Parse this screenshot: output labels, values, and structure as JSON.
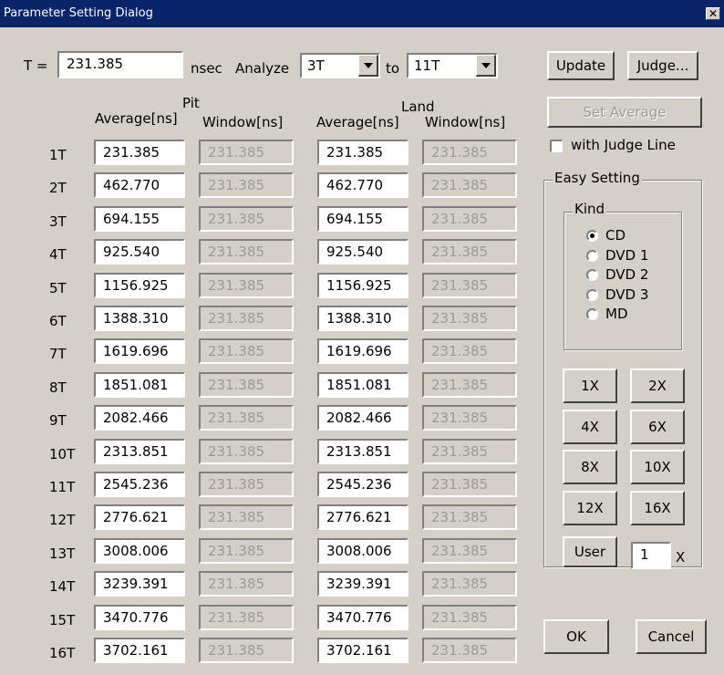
{
  "window": {
    "title": "Parameter Setting Dialog",
    "close_glyph": "✕"
  },
  "t_row": {
    "t_label": "T =",
    "t_value": "231.385",
    "unit": "nsec",
    "analyze_label": "Analyze",
    "from": "3T",
    "to_label": "to",
    "to": "11T"
  },
  "headers": {
    "pit": "Pit",
    "land": "Land",
    "average": "Average[ns]",
    "window": "Window[ns]"
  },
  "rows": [
    {
      "label": "1T",
      "pit_avg": "231.385",
      "pit_win": "231.385",
      "land_avg": "231.385",
      "land_win": "231.385"
    },
    {
      "label": "2T",
      "pit_avg": "462.770",
      "pit_win": "231.385",
      "land_avg": "462.770",
      "land_win": "231.385"
    },
    {
      "label": "3T",
      "pit_avg": "694.155",
      "pit_win": "231.385",
      "land_avg": "694.155",
      "land_win": "231.385"
    },
    {
      "label": "4T",
      "pit_avg": "925.540",
      "pit_win": "231.385",
      "land_avg": "925.540",
      "land_win": "231.385"
    },
    {
      "label": "5T",
      "pit_avg": "1156.925",
      "pit_win": "231.385",
      "land_avg": "1156.925",
      "land_win": "231.385"
    },
    {
      "label": "6T",
      "pit_avg": "1388.310",
      "pit_win": "231.385",
      "land_avg": "1388.310",
      "land_win": "231.385"
    },
    {
      "label": "7T",
      "pit_avg": "1619.696",
      "pit_win": "231.385",
      "land_avg": "1619.696",
      "land_win": "231.385"
    },
    {
      "label": "8T",
      "pit_avg": "1851.081",
      "pit_win": "231.385",
      "land_avg": "1851.081",
      "land_win": "231.385"
    },
    {
      "label": "9T",
      "pit_avg": "2082.466",
      "pit_win": "231.385",
      "land_avg": "2082.466",
      "land_win": "231.385"
    },
    {
      "label": "10T",
      "pit_avg": "2313.851",
      "pit_win": "231.385",
      "land_avg": "2313.851",
      "land_win": "231.385"
    },
    {
      "label": "11T",
      "pit_avg": "2545.236",
      "pit_win": "231.385",
      "land_avg": "2545.236",
      "land_win": "231.385"
    },
    {
      "label": "12T",
      "pit_avg": "2776.621",
      "pit_win": "231.385",
      "land_avg": "2776.621",
      "land_win": "231.385"
    },
    {
      "label": "13T",
      "pit_avg": "3008.006",
      "pit_win": "231.385",
      "land_avg": "3008.006",
      "land_win": "231.385"
    },
    {
      "label": "14T",
      "pit_avg": "3239.391",
      "pit_win": "231.385",
      "land_avg": "3239.391",
      "land_win": "231.385"
    },
    {
      "label": "15T",
      "pit_avg": "3470.776",
      "pit_win": "231.385",
      "land_avg": "3470.776",
      "land_win": "231.385"
    },
    {
      "label": "16T",
      "pit_avg": "3702.161",
      "pit_win": "231.385",
      "land_avg": "3702.161",
      "land_win": "231.385"
    }
  ],
  "buttons": {
    "update": "Update",
    "judge": "Judge...",
    "set_average": "Set Average",
    "ok": "OK",
    "cancel": "Cancel",
    "user": "User"
  },
  "judge_line": {
    "label": "with Judge Line",
    "checked": false
  },
  "easy_setting": {
    "title": "Easy Setting",
    "kind_title": "Kind",
    "kinds": [
      {
        "label": "CD",
        "selected": true
      },
      {
        "label": "DVD 1",
        "selected": false
      },
      {
        "label": "DVD 2",
        "selected": false
      },
      {
        "label": "DVD 3",
        "selected": false
      },
      {
        "label": "MD",
        "selected": false
      }
    ],
    "speeds": [
      "1X",
      "2X",
      "4X",
      "6X",
      "8X",
      "10X",
      "12X",
      "16X"
    ],
    "user_multiplier": "1",
    "multiplier_suffix": "X"
  }
}
